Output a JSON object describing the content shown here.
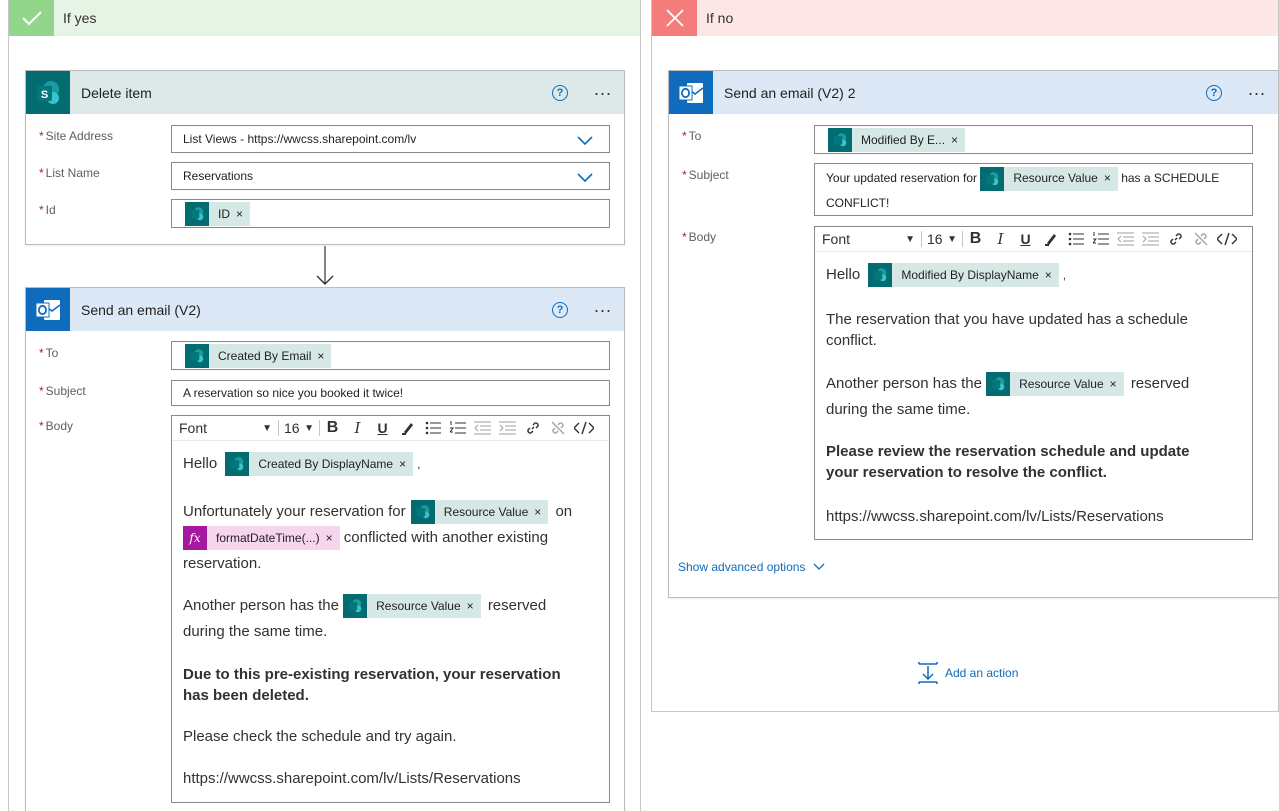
{
  "left_branch": {
    "label": "If yes",
    "delete_item": {
      "title": "Delete item",
      "fields": {
        "site_address_label": "Site Address",
        "site_address_value": "List Views - https://wwcss.sharepoint.com/lv",
        "list_name_label": "List Name",
        "list_name_value": "Reservations",
        "id_label": "Id",
        "id_token": "ID"
      }
    },
    "send_email": {
      "title": "Send an email (V2)",
      "to_label": "To",
      "to_token": "Created By Email",
      "subject_label": "Subject",
      "subject_value": "A reservation so nice you booked it twice!",
      "body_label": "Body",
      "toolbar": {
        "font": "Font",
        "size": "16"
      },
      "body": {
        "hello": "Hello",
        "hello_token": "Created By DisplayName",
        "comma": ",",
        "p1_a": "Unfortunately your reservation for",
        "p1_token": "Resource Value",
        "p1_b": "on",
        "p1_fx_token": "formatDateTime(...)",
        "p1_c": "conflicted with another existing",
        "p1_d": "reservation.",
        "p2_a": "Another person has the",
        "p2_token": "Resource Value",
        "p2_b": "reserved",
        "p2_c": "during the same time.",
        "p3_a": "Due to this pre-existing reservation, your reservation",
        "p3_b": "has been deleted.",
        "p4": "Please check the schedule and try again.",
        "p5": "https://wwcss.sharepoint.com/lv/Lists/Reservations"
      }
    }
  },
  "right_branch": {
    "label": "If no",
    "send_email": {
      "title": "Send an email (V2) 2",
      "to_label": "To",
      "to_token": "Modified By E...",
      "subject_label": "Subject",
      "subject_a": "Your updated reservation for",
      "subject_token": "Resource Value",
      "subject_b": "has a SCHEDULE",
      "subject_c": "CONFLICT!",
      "body_label": "Body",
      "toolbar": {
        "font": "Font",
        "size": "16"
      },
      "body": {
        "hello": "Hello",
        "hello_token": "Modified By DisplayName",
        "comma": ",",
        "p1_a": "The reservation that you have updated has a schedule",
        "p1_b": "conflict.",
        "p2_a": "Another person has the",
        "p2_token": "Resource Value",
        "p2_b": "reserved",
        "p2_c": "during the same time.",
        "p3_a": "Please review the reservation schedule and update",
        "p3_b": "your reservation to resolve the conflict.",
        "p4": "https://wwcss.sharepoint.com/lv/Lists/Reservations"
      },
      "advanced": "Show advanced options"
    },
    "add_action": "Add an action"
  },
  "colors": {
    "yes_header": "#e5f4e5",
    "yes_icon": "#92d68c",
    "no_header": "#fce6e6",
    "no_icon": "#f47c7a",
    "sharepoint": "#036c70",
    "outlook": "#0f6cbd",
    "expression": "#a4199f"
  },
  "icons": [
    "checkmark-icon",
    "close-icon",
    "sharepoint-icon",
    "outlook-icon",
    "help-icon",
    "more-icon",
    "chevron-down-icon",
    "bold-icon",
    "italic-icon",
    "underline-icon",
    "highlight-icon",
    "bullet-list-icon",
    "numbered-list-icon",
    "decrease-indent-icon",
    "increase-indent-icon",
    "link-icon",
    "unlink-icon",
    "code-view-icon",
    "token-remove-icon",
    "add-action-icon",
    "arrow-down-icon"
  ]
}
